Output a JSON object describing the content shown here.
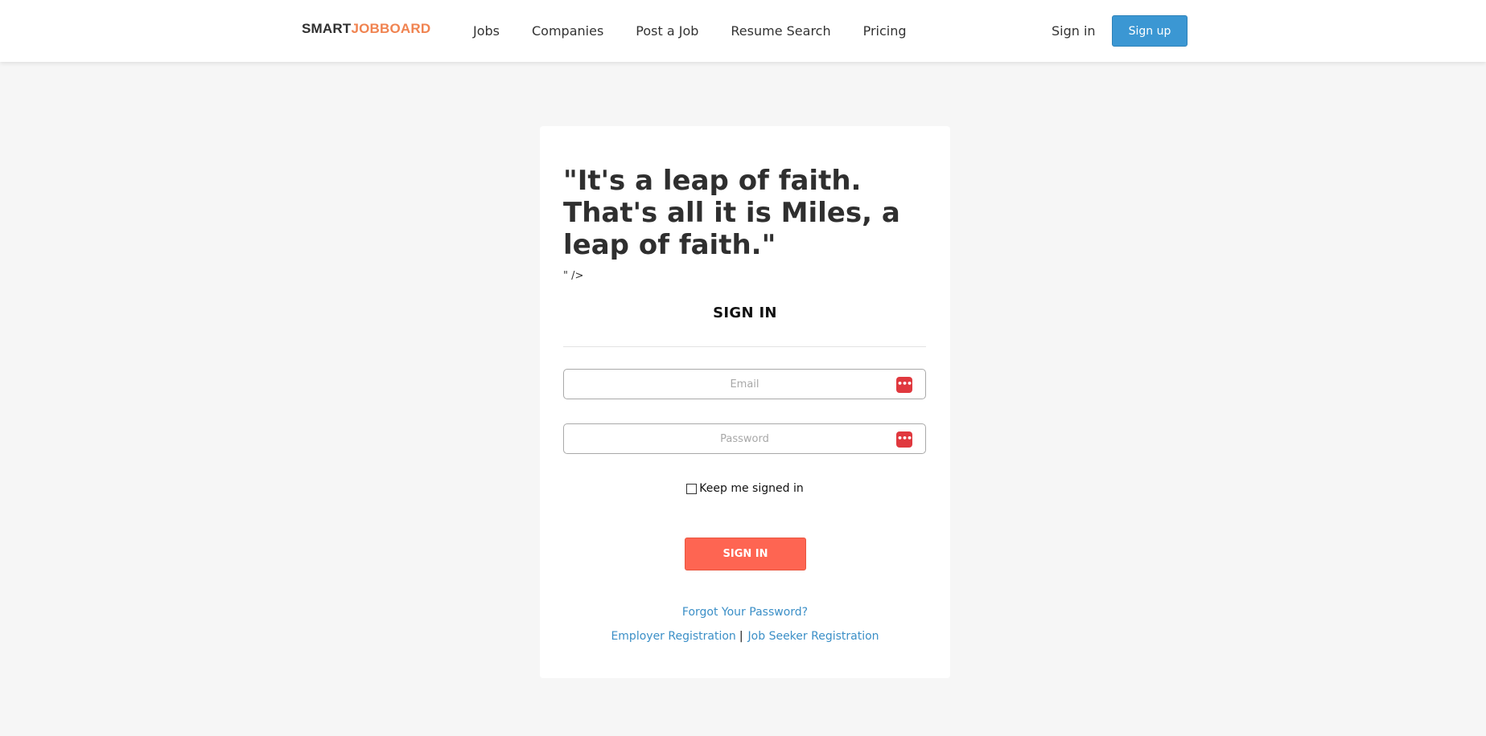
{
  "header": {
    "logo_part1": "SMART",
    "logo_part2": "JOBBOARD",
    "nav": {
      "jobs": "Jobs",
      "companies": "Companies",
      "post_job": "Post a Job",
      "resume_search": "Resume Search",
      "pricing": "Pricing"
    },
    "sign_in": "Sign in",
    "sign_up": "Sign up"
  },
  "card": {
    "quote": "\"It's a leap of faith. That's all it is Miles, a leap of faith.\"",
    "artifact_text": "\" />",
    "title": "SIGN IN",
    "email_placeholder": "Email",
    "email_value": "",
    "password_placeholder": "Password",
    "password_value": "",
    "password_manager_icon": "password-manager-icon",
    "keep_signed_in": "Keep me signed in",
    "keep_signed_in_checked": false,
    "submit": "SIGN IN",
    "forgot_password": "Forgot Your Password?",
    "employer_registration": "Employer Registration",
    "separator": "|",
    "job_seeker_registration": "Job Seeker Registration"
  },
  "colors": {
    "brand_dark": "#2f2f2f",
    "brand_accent": "#f08350",
    "sign_up_button": "#3b97d3",
    "submit_button": "#fe6552",
    "link": "#3b8fc7",
    "password_manager": "#e0383e",
    "page_background": "#f6f6f6"
  }
}
